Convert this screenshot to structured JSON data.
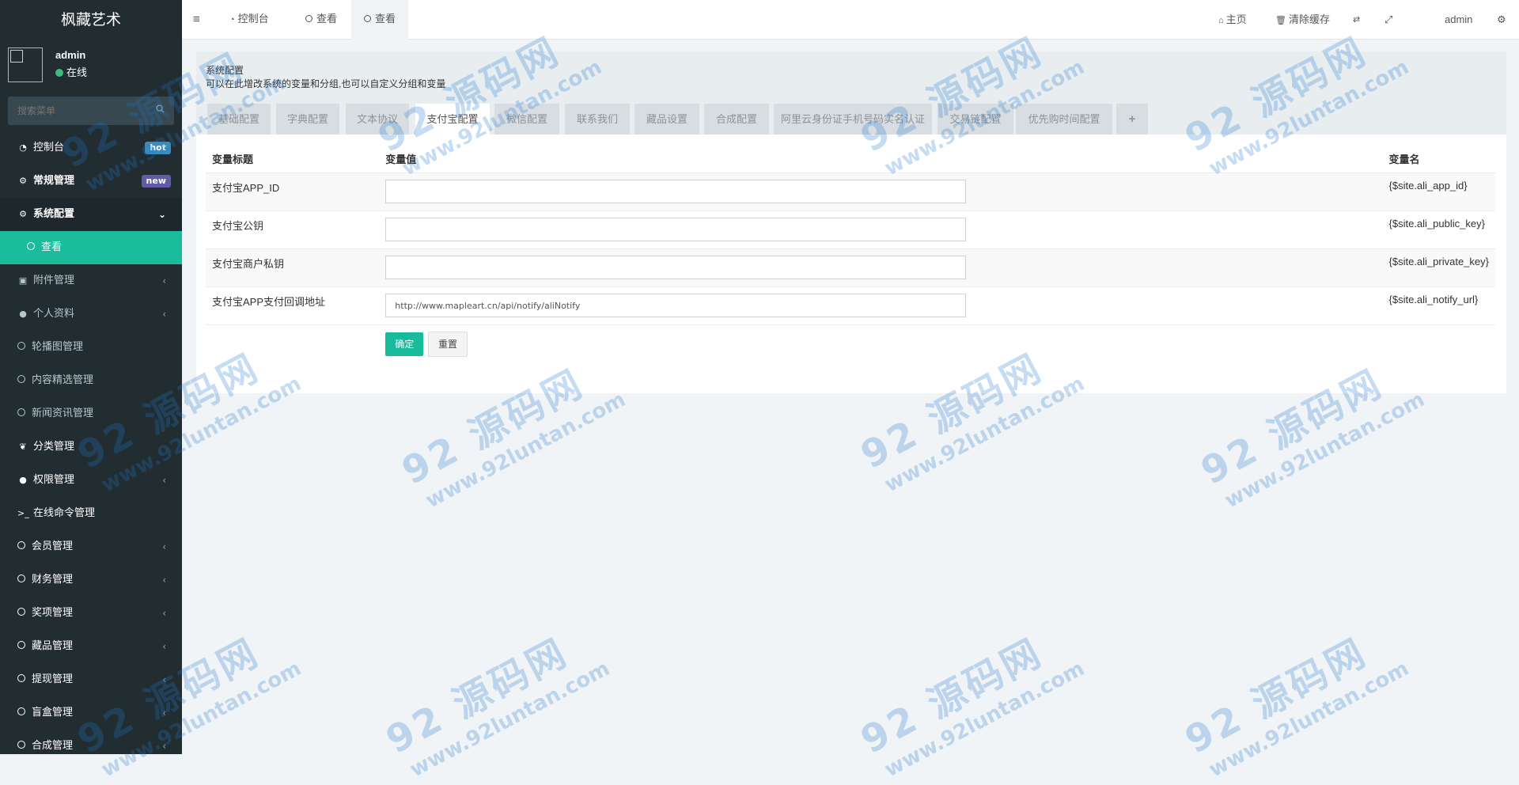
{
  "app": {
    "brand": "枫藏艺术"
  },
  "user": {
    "name": "admin",
    "status": "在线"
  },
  "search": {
    "placeholder": "搜索菜单"
  },
  "sidebar": {
    "items": [
      {
        "label": "控制台",
        "badge": "hot"
      },
      {
        "label": "常规管理",
        "badge": "new"
      },
      {
        "label": "系统配置"
      },
      {
        "label": "查看"
      },
      {
        "label": "附件管理"
      },
      {
        "label": "个人资料"
      },
      {
        "label": "轮播图管理"
      },
      {
        "label": "内容精选管理"
      },
      {
        "label": "新闻资讯管理"
      },
      {
        "label": "分类管理"
      },
      {
        "label": "权限管理"
      },
      {
        "label": "在线命令管理"
      },
      {
        "label": "会员管理"
      },
      {
        "label": "财务管理"
      },
      {
        "label": "奖项管理"
      },
      {
        "label": "藏品管理"
      },
      {
        "label": "提现管理"
      },
      {
        "label": "盲盒管理"
      },
      {
        "label": "合成管理"
      }
    ]
  },
  "topbar": {
    "tabs": [
      "控制台",
      "查看",
      "查看"
    ],
    "home": "主页",
    "clear_cache": "清除缓存",
    "user": "admin"
  },
  "header": {
    "title": "系统配置",
    "description": "可以在此增改系统的变量和分组,也可以自定义分组和变量"
  },
  "config_tabs": [
    "基础配置",
    "字典配置",
    "文本协议",
    "支付宝配置",
    "微信配置",
    "联系我们",
    "藏品设置",
    "合成配置",
    "阿里云身份证手机号码实名认证",
    "交易链配置",
    "优先购时间配置",
    "+"
  ],
  "table": {
    "headers": [
      "变量标题",
      "变量值",
      "变量名"
    ],
    "rows": [
      {
        "title": "支付宝APP_ID",
        "value": "",
        "name": "{$site.ali_app_id}"
      },
      {
        "title": "支付宝公钥",
        "value": "",
        "name": "{$site.ali_public_key}"
      },
      {
        "title": "支付宝商户私钥",
        "value": "",
        "name": "{$site.ali_private_key}"
      },
      {
        "title": "支付宝APP支付回调地址",
        "value": "http://www.mapleart.cn/api/notify/aliNotify",
        "name": "{$site.ali_notify_url}"
      }
    ]
  },
  "buttons": {
    "submit": "确定",
    "reset": "重置"
  },
  "watermark": {
    "text": "92 源码网",
    "url": "www.92luntan.com"
  },
  "colors": {
    "sidebar_bg": "#222d32",
    "accent": "#18bc9c",
    "hot": "#3c8dbc",
    "new": "#605ca8"
  }
}
